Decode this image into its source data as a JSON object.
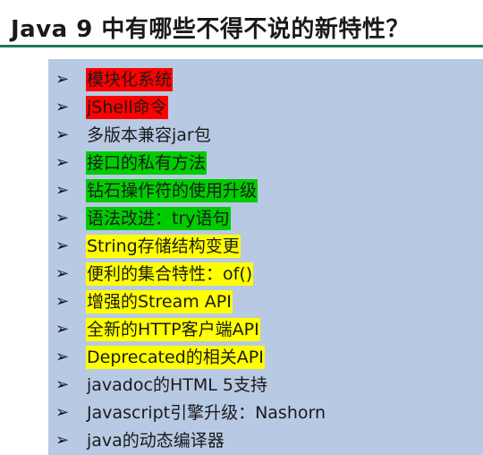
{
  "slide": {
    "title": "Java 9 中有哪些不得不说的新特性？",
    "bullet_glyph": "➢",
    "highlight_colors": {
      "red": "#ff0000",
      "green": "#00cc00",
      "yellow": "#ffff00"
    },
    "items": [
      {
        "text": "模块化系统",
        "highlight": "red"
      },
      {
        "text": "jShell命令",
        "highlight": "red"
      },
      {
        "text": "多版本兼容jar包",
        "highlight": "none"
      },
      {
        "text": "接口的私有方法",
        "highlight": "green"
      },
      {
        "text": "钻石操作符的使用升级",
        "highlight": "green"
      },
      {
        "text": "语法改进：try语句",
        "highlight": "green"
      },
      {
        "text": "String存储结构变更",
        "highlight": "yellow"
      },
      {
        "text": "便利的集合特性：of()",
        "highlight": "yellow"
      },
      {
        "text": "增强的Stream API",
        "highlight": "yellow"
      },
      {
        "text": "全新的HTTP客户端API",
        "highlight": "yellow"
      },
      {
        "text": "Deprecated的相关API",
        "highlight": "yellow"
      },
      {
        "text": "javadoc的HTML 5支持",
        "highlight": "none"
      },
      {
        "text": "Javascript引擎升级：Nashorn",
        "highlight": "none"
      },
      {
        "text": "java的动态编译器",
        "highlight": "none"
      }
    ]
  }
}
